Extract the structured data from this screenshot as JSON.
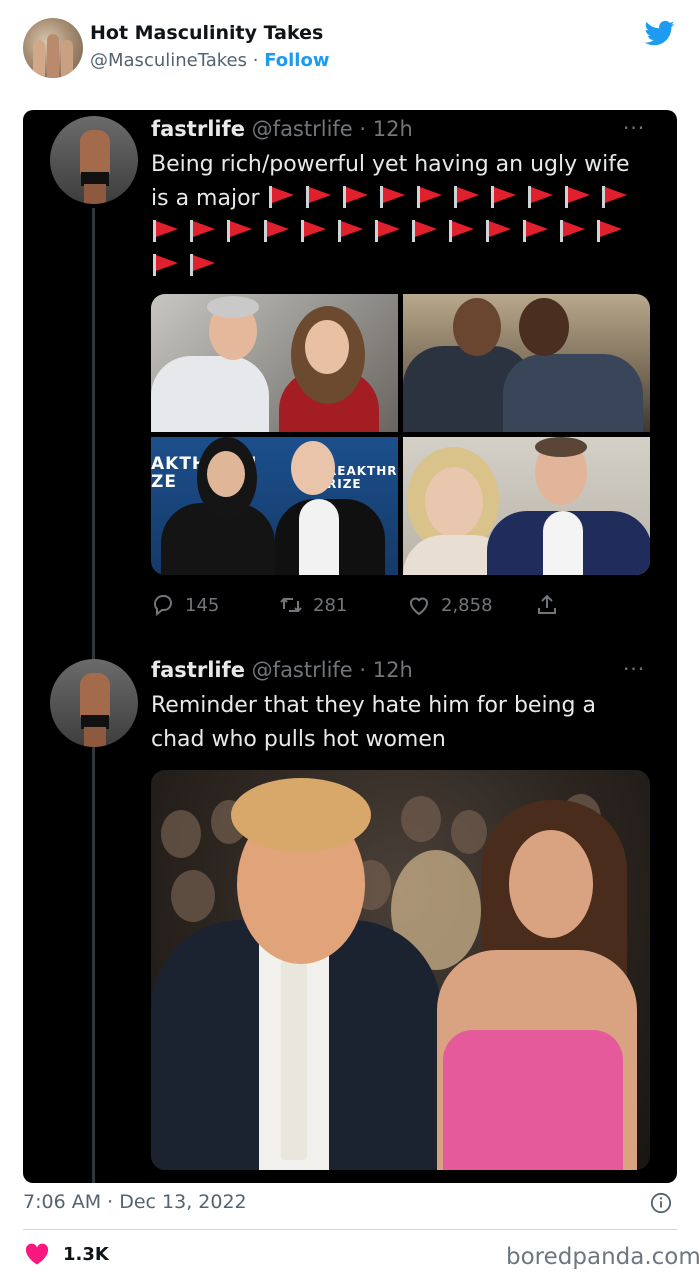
{
  "outer_tweet": {
    "display_name": "Hot Masculinity Takes",
    "handle": "@MasculineTakes",
    "separator": " · ",
    "follow_label": "Follow",
    "timestamp": "7:06 AM · Dec 13, 2022",
    "like_count": "1.3K"
  },
  "colors": {
    "twitter_blue": "#1d9bf0",
    "like_pink": "#f91880",
    "card_bg": "#000000"
  },
  "embedded_thread": {
    "tweets": [
      {
        "name": "fastrlife",
        "handle": "@fastrlife",
        "time": "12h",
        "text": "Being rich/powerful yet having an ugly wife is a major",
        "flag_count": 25,
        "photo_sign_left": "AKTHI    H\nZE",
        "photo_sign_right": "REAKTHROU\nRIZE",
        "replies": "145",
        "retweets": "281",
        "likes": "2,858"
      },
      {
        "name": "fastrlife",
        "handle": "@fastrlife",
        "time": "12h",
        "text": "Reminder that they hate him for being a chad who pulls hot women"
      }
    ],
    "more_glyph": "···"
  },
  "credit": "boredpanda.com"
}
